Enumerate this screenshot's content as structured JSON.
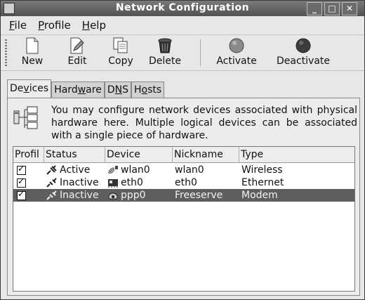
{
  "window": {
    "title": "Network Configuration"
  },
  "window_controls": {
    "minimize": "_",
    "maximize": "□",
    "close": "✕"
  },
  "menubar": [
    {
      "pre": "",
      "u": "F",
      "post": "ile"
    },
    {
      "pre": "",
      "u": "P",
      "post": "rofile"
    },
    {
      "pre": "",
      "u": "H",
      "post": "elp"
    }
  ],
  "toolbar": {
    "new": "New",
    "edit": "Edit",
    "copy": "Copy",
    "delete": "Delete",
    "activate": "Activate",
    "deactivate": "Deactivate"
  },
  "tabs": [
    {
      "pre": "De",
      "u": "v",
      "post": "ices"
    },
    {
      "pre": "Hard",
      "u": "w",
      "post": "are"
    },
    {
      "pre": "D",
      "u": "N",
      "post": "S"
    },
    {
      "pre": "H",
      "u": "o",
      "post": "sts"
    }
  ],
  "info": {
    "text": "You may configure network devices associated with physical hardware here. Multiple logical devices can be associated with a single piece of hardware."
  },
  "table": {
    "columns": [
      "Profil",
      "Status",
      "Device",
      "Nickname",
      "Type"
    ],
    "rows": [
      {
        "status": "Active",
        "device": "wlan0",
        "nickname": "wlan0",
        "type": "Wireless"
      },
      {
        "status": "Inactive",
        "device": "eth0",
        "nickname": "eth0",
        "type": "Ethernet"
      },
      {
        "status": "Inactive",
        "device": "ppp0",
        "nickname": "Freeserve",
        "type": "Modem"
      }
    ]
  }
}
